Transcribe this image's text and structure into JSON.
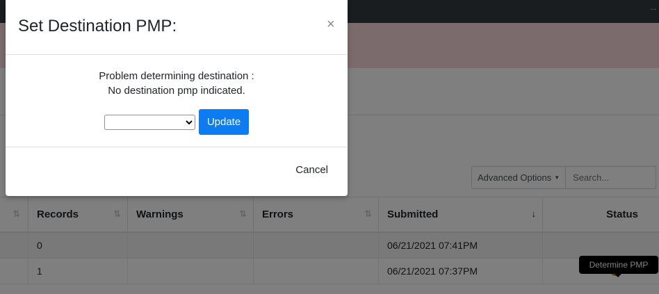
{
  "background": {
    "user_text": "..."
  },
  "toolbar": {
    "advanced_options_label": "Advanced Options",
    "search_placeholder": "Search..."
  },
  "table": {
    "headers": [
      {
        "label": "",
        "sort": "⇅"
      },
      {
        "label": "Records",
        "sort": "⇅"
      },
      {
        "label": "Warnings",
        "sort": "⇅"
      },
      {
        "label": "Errors",
        "sort": "⇅"
      },
      {
        "label": "Submitted",
        "sort": "↓"
      },
      {
        "label": "Status",
        "sort": ""
      }
    ],
    "rows": [
      {
        "records": "0",
        "warnings": "",
        "errors": "",
        "submitted": "06/21/2021 07:41PM",
        "status": ""
      },
      {
        "records": "1",
        "warnings": "",
        "errors": "",
        "submitted": "06/21/2021 07:37PM",
        "status": "?"
      }
    ]
  },
  "tooltip": {
    "text": "Determine PMP"
  },
  "modal": {
    "title": "Set Destination PMP:",
    "close_label": "×",
    "message_line1": "Problem determining destination :",
    "message_line2": "No destination pmp indicated.",
    "select_value": "",
    "update_label": "Update",
    "cancel_label": "Cancel"
  },
  "colors": {
    "primary": "#0d7cf2",
    "warning_icon": "#c9890a",
    "topbar": "#343a40",
    "alert": "#f8d7da"
  }
}
